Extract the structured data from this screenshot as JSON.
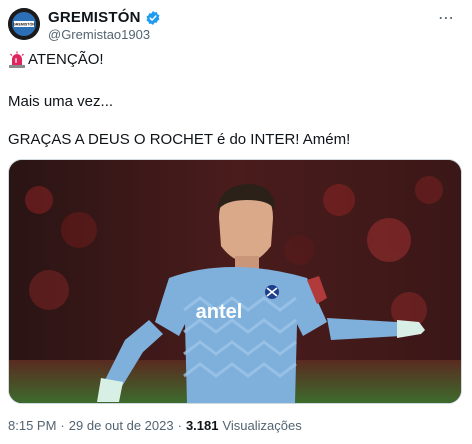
{
  "tweet": {
    "display_name": "GREMISTÓN",
    "handle": "@Gremistao1903",
    "line1": "ATENÇÃO!",
    "line2": "Mais uma vez...",
    "line3": "GRAÇAS A DEUS O ROCHET é do INTER! Amém!",
    "time": "8:15 PM",
    "date": "29 de out de 2023",
    "views_count": "3.181",
    "views_label": "Visualizações",
    "separator": "·",
    "avatar_text": "GREMISTÓN",
    "more_label": "⋯"
  },
  "media": {
    "sponsor_text": "antel"
  },
  "icons": {
    "verified": "verified-badge-icon",
    "siren": "police-siren-icon",
    "more": "more-options-icon"
  },
  "colors": {
    "verified_blue": "#1d9bf0",
    "secondary_text": "#536471",
    "jersey": "#7fb0dc"
  }
}
